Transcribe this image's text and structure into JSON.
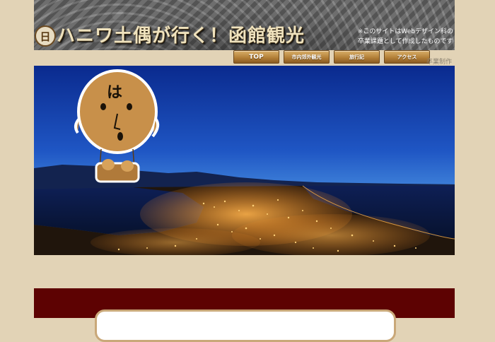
{
  "header": {
    "logo_glyph": "日",
    "title": "ハニワ土偶が行く！函館観光",
    "notice_line1": "※このサイトはWebデザイン科の",
    "notice_line2": "卒業課題として作成したものです"
  },
  "nav": {
    "items": [
      {
        "label": "TOP"
      },
      {
        "label": "市内郊外観光"
      },
      {
        "label": "旅行記"
      },
      {
        "label": "アクセス"
      }
    ],
    "note": "卒業制作"
  },
  "hero": {
    "mascot_glyph": "は"
  },
  "colors": {
    "page_bg": "#e2d3b6",
    "nav_gold": "#b07d35",
    "panel_red": "#5d0202"
  }
}
